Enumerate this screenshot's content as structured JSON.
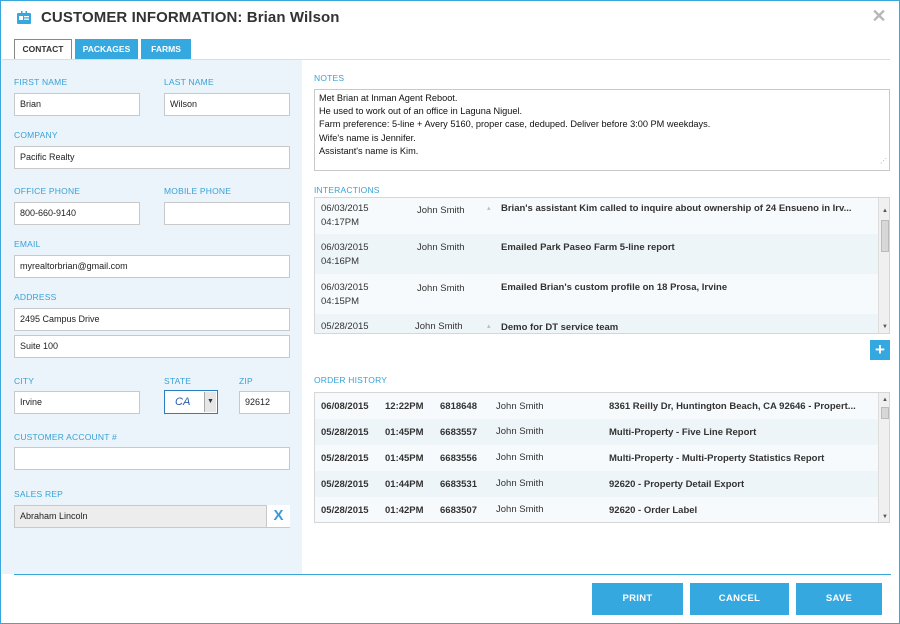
{
  "window": {
    "title": "CUSTOMER INFORMATION: Brian Wilson",
    "title_icon": "contact-card-icon",
    "close_icon": "close-icon"
  },
  "tabs": [
    {
      "label": "CONTACT",
      "active": true
    },
    {
      "label": "PACKAGES",
      "active": false
    },
    {
      "label": "FARMS",
      "active": false
    }
  ],
  "contact": {
    "first_name_label": "FIRST NAME",
    "first_name": "Brian",
    "last_name_label": "LAST NAME",
    "last_name": "Wilson",
    "company_label": "COMPANY",
    "company": "Pacific Realty",
    "office_phone_label": "OFFICE PHONE",
    "office_phone": "800-660-9140",
    "mobile_phone_label": "MOBILE PHONE",
    "mobile_phone": "",
    "email_label": "EMAIL",
    "email": "myrealtorbrian@gmail.com",
    "address_label": "ADDRESS",
    "address1": "2495 Campus Drive",
    "address2": "Suite 100",
    "city_label": "CITY",
    "city": "Irvine",
    "state_label": "STATE",
    "state": "CA",
    "zip_label": "ZIP",
    "zip": "92612",
    "account_label": "CUSTOMER ACCOUNT #",
    "account": "",
    "sales_rep_label": "SALES REP",
    "sales_rep": "Abraham Lincoln",
    "clear_label": "X"
  },
  "notes": {
    "label": "NOTES",
    "lines": [
      "Met Brian at Inman Agent Reboot.",
      "He used to work out of an office in Laguna Niguel.",
      "Farm preference: 5-line + Avery 5160, proper case, deduped. Deliver before 3:00 PM weekdays.",
      "Wife's name is Jennifer.",
      "Assistant's name is Kim."
    ]
  },
  "interactions": {
    "label": "INTERACTIONS",
    "rows": [
      {
        "date": "06/03/2015",
        "time": "04:17PM",
        "user": "John Smith",
        "text": "Brian's assistant Kim called to inquire about ownership of 24 Ensueno in Irv..."
      },
      {
        "date": "06/03/2015",
        "time": "04:16PM",
        "user": "John Smith",
        "text": "Emailed Park Paseo Farm 5-line report"
      },
      {
        "date": "06/03/2015",
        "time": "04:15PM",
        "user": "John Smith",
        "text": "Emailed Brian's custom profile on 18 Prosa, Irvine"
      },
      {
        "date": "05/28/2015",
        "time": "",
        "user": "John Smith",
        "text": "Demo for DT service team"
      }
    ],
    "add_label": "+"
  },
  "orders": {
    "label": "ORDER HISTORY",
    "rows": [
      {
        "date": "06/08/2015",
        "time": "12:22PM",
        "order": "6818648",
        "user": "John Smith",
        "desc": "8361 Reilly Dr, Huntington Beach, CA 92646 - Propert..."
      },
      {
        "date": "05/28/2015",
        "time": "01:45PM",
        "order": "6683557",
        "user": "John Smith",
        "desc": "Multi-Property - Five Line Report"
      },
      {
        "date": "05/28/2015",
        "time": "01:45PM",
        "order": "6683556",
        "user": "John Smith",
        "desc": "Multi-Property - Multi-Property Statistics Report"
      },
      {
        "date": "05/28/2015",
        "time": "01:44PM",
        "order": "6683531",
        "user": "John Smith",
        "desc": "92620 - Property Detail Export"
      },
      {
        "date": "05/28/2015",
        "time": "01:42PM",
        "order": "6683507",
        "user": "John Smith",
        "desc": "92620 - Order Label"
      }
    ]
  },
  "buttons": {
    "print": "PRINT",
    "cancel": "CANCEL",
    "save": "SAVE"
  },
  "colors": {
    "accent": "#36a8e0",
    "panel": "#eaf4fa",
    "label": "#3aa1d6"
  }
}
